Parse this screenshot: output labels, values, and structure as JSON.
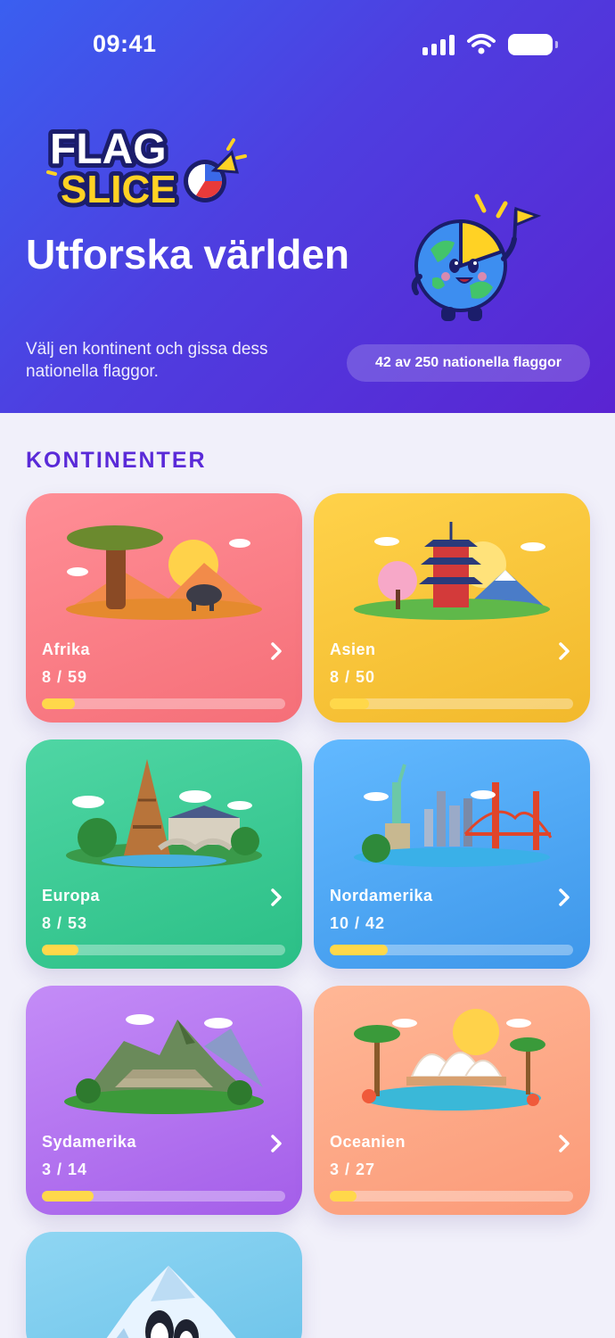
{
  "status_bar": {
    "time": "09:41"
  },
  "header": {
    "title": "Utforska världen",
    "subtitle": "Välj en kontinent och gissa dess nationella flaggor.",
    "progress_label": "42 av 250 nationella flaggor"
  },
  "section": {
    "title": "KONTINENTER"
  },
  "continents": [
    {
      "name": "Afrika",
      "count": "8 / 59",
      "progress": 0.136
    },
    {
      "name": "Asien",
      "count": "8 / 50",
      "progress": 0.16
    },
    {
      "name": "Europa",
      "count": "8 / 53",
      "progress": 0.151
    },
    {
      "name": "Nordamerika",
      "count": "10 / 42",
      "progress": 0.238
    },
    {
      "name": "Sydamerika",
      "count": "3 / 14",
      "progress": 0.214
    },
    {
      "name": "Oceanien",
      "count": "3 / 27",
      "progress": 0.111
    }
  ],
  "colors": {
    "accent": "#5a2ad8",
    "progress_fill": "#ffd84a"
  },
  "icons": [
    "signal-icon",
    "wifi-icon",
    "battery-icon",
    "chevron-right-icon"
  ]
}
